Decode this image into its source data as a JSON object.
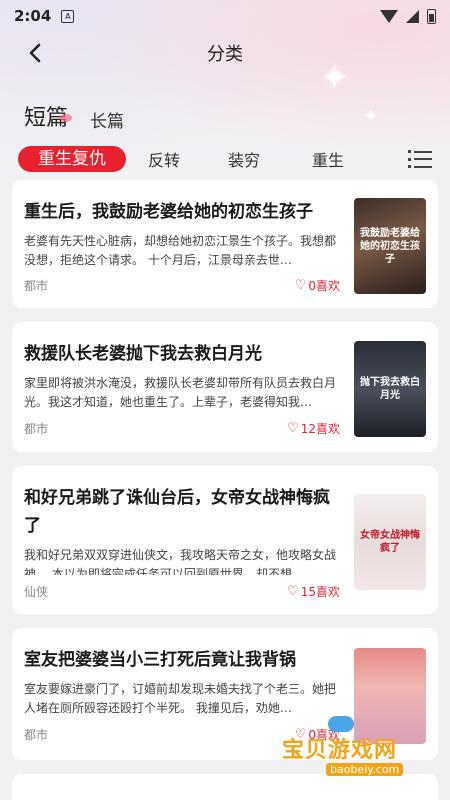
{
  "status_bar": {
    "time": "2:04",
    "notif_glyph": "A"
  },
  "nav": {
    "title": "分类"
  },
  "length_tabs": [
    {
      "label": "短篇",
      "active": true
    },
    {
      "label": "长篇",
      "active": false
    }
  ],
  "genre_tabs": [
    {
      "label": "重生复仇",
      "active": true
    },
    {
      "label": "反转",
      "active": false
    },
    {
      "label": "装穷",
      "active": false
    },
    {
      "label": "重生",
      "active": false
    }
  ],
  "books": [
    {
      "title": "重生后，我鼓励老婆给她的初恋生孩子",
      "desc": "老婆有先天性心脏病，却想给她初恋江景生个孩子。我想都没想，拒绝这个请求。 十个月后，江景母亲去世…",
      "tag": "都市",
      "likes": "0喜欢",
      "cover_text": "我鼓励老婆给她的初恋生孩子"
    },
    {
      "title": "救援队长老婆抛下我去救白月光",
      "desc": "家里即将被洪水淹没，救援队长老婆却带所有队员去救白月光。我这才知道，她也重生了。上辈子，老婆得知我…",
      "tag": "都市",
      "likes": "12喜欢",
      "cover_text": "抛下我去救白月光"
    },
    {
      "title": "和好兄弟跳了诛仙台后，女帝女战神悔疯了",
      "desc": "我和好兄弟双双穿进仙侠文，我攻略天帝之女，他攻略女战神。 本以为即将完成任务可以回到原世界，却不想…",
      "tag": "仙侠",
      "likes": "15喜欢",
      "cover_text": "女帝女战神悔疯了"
    },
    {
      "title": "室友把婆婆当小三打死后竟让我背锅",
      "desc": "室友要嫁进豪门了，订婚前却发现未婚夫找了个老三。她把人堵在厕所殴容还殴打个半死。 我撞见后，劝她…",
      "tag": "都市",
      "likes": "0喜欢",
      "cover_text": ""
    }
  ],
  "watermark": {
    "text": "宝贝游戏网",
    "url": "baobeiy.com"
  },
  "icons": {
    "back": "back-arrow-icon",
    "menu": "list-menu-icon",
    "heart": "heart-outline-icon"
  },
  "colors": {
    "accent": "#e8212f",
    "background": "#f1f1f4"
  }
}
